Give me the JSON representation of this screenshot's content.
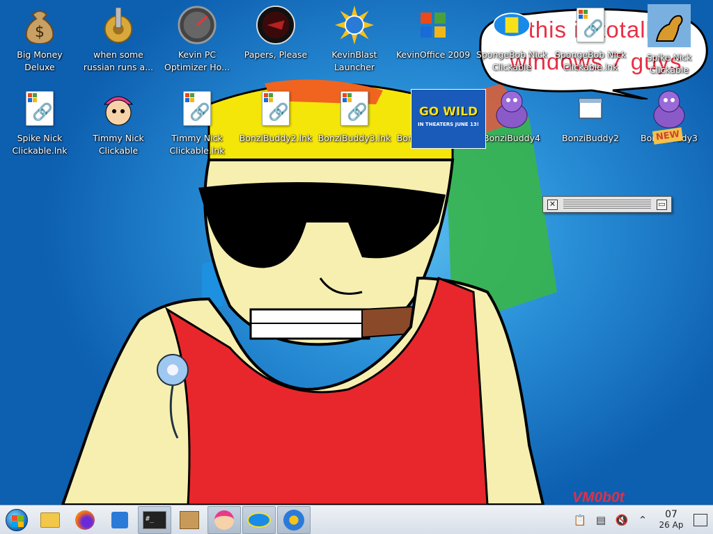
{
  "desktop": {
    "icons_row1": [
      {
        "label": "Big Money Deluxe",
        "icon": "money-bag-icon"
      },
      {
        "label": "when some russian runs a...",
        "icon": "gear-icon"
      },
      {
        "label": "Kevin PC Optimizer Ho...",
        "icon": "gauge-icon"
      },
      {
        "label": "Papers, Please",
        "icon": "papers-please-seal-icon"
      },
      {
        "label": "KevinBlast Launcher",
        "icon": "sun-globe-icon"
      },
      {
        "label": "KevinOffice 2009",
        "icon": "office-logo-icon"
      },
      {
        "label": "SpongeBob Nick Clickable",
        "icon": "nick-logo-icon"
      },
      {
        "label": "SpongeBob Nick Clickable.lnk",
        "icon": "shortcut-file-icon"
      },
      {
        "label": "Spike Nick Clickable",
        "icon": "dog-icon"
      }
    ],
    "icons_row2": [
      {
        "label": "Spike Nick Clickable.lnk",
        "icon": "shortcut-file-icon"
      },
      {
        "label": "Timmy Nick Clickable",
        "icon": "timmy-icon"
      },
      {
        "label": "Timmy Nick Clickable.lnk",
        "icon": "shortcut-file-icon"
      },
      {
        "label": "BonziBuddy2.lnk",
        "icon": "shortcut-file-icon"
      },
      {
        "label": "BonziBuddy3.lnk",
        "icon": "shortcut-file-icon"
      },
      {
        "label": "BonziBuddy4.lnk",
        "icon": "shortcut-file-icon"
      },
      {
        "label": "BonziBuddy4",
        "icon": "purple-gorilla-icon"
      },
      {
        "label": "BonziBuddy2",
        "icon": "window-icon"
      },
      {
        "label": "BonziBuddy3",
        "icon": "purple-gorilla-icon"
      }
    ],
    "speech_bubble": "this is totally windows 7 guys",
    "movie_poster": {
      "line1": "GO WILD",
      "line2": "IN THEATERS JUNE 13!"
    },
    "poster_badge": "NEW",
    "watermark": "VM0b0t"
  },
  "taskbar": {
    "start_icon": "windows-orb-icon",
    "pinned": [
      {
        "name": "file-explorer",
        "icon": "folder-icon"
      },
      {
        "name": "firefox",
        "icon": "firefox-icon"
      },
      {
        "name": "store",
        "icon": "store-bag-icon"
      },
      {
        "name": "terminal",
        "icon": "terminal-icon",
        "text": "#_"
      },
      {
        "name": "package",
        "icon": "package-icon"
      },
      {
        "name": "timmy",
        "icon": "timmy-icon"
      },
      {
        "name": "nick",
        "icon": "nick-logo-icon"
      },
      {
        "name": "kevinblast",
        "icon": "wrench-icon"
      }
    ],
    "tray": {
      "clock_time": "07",
      "clock_date": "26 Ap"
    }
  },
  "colors": {
    "accent_red": "#e83044",
    "desktop_blue": "#1a78c8"
  }
}
